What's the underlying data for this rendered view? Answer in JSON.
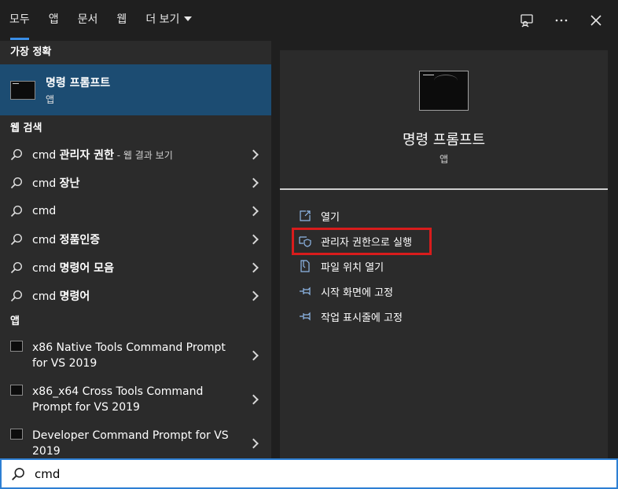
{
  "tabs": {
    "all": "모두",
    "apps": "앱",
    "documents": "문서",
    "web": "웹",
    "more": "더 보기"
  },
  "left": {
    "best_match_label": "가장 정확",
    "best_match": {
      "title": "명령 프롬프트",
      "subtitle": "앱"
    },
    "web_search_label": "웹 검색",
    "web_items": [
      {
        "prefix": "cmd ",
        "bold": "관리자 권한",
        "hint": " - 웹 결과 보기"
      },
      {
        "prefix": "cmd ",
        "bold": "장난",
        "hint": ""
      },
      {
        "prefix": "cmd",
        "bold": "",
        "hint": ""
      },
      {
        "prefix": "cmd ",
        "bold": "정품인증",
        "hint": ""
      },
      {
        "prefix": "cmd ",
        "bold": "명령어 모음",
        "hint": ""
      },
      {
        "prefix": "cmd ",
        "bold": "명령어",
        "hint": ""
      }
    ],
    "apps_label": "앱",
    "app_items": [
      {
        "label": "x86 Native Tools Command Prompt for VS 2019"
      },
      {
        "label": "x86_x64 Cross Tools Command Prompt for VS 2019"
      },
      {
        "label": "Developer Command Prompt for VS 2019"
      }
    ]
  },
  "detail": {
    "title": "명령 프롬프트",
    "subtitle": "앱",
    "actions": [
      {
        "label": "열기",
        "icon": "open-icon"
      },
      {
        "label": "관리자 권한으로 실행",
        "icon": "shield-icon"
      },
      {
        "label": "파일 위치 열기",
        "icon": "file-location-icon"
      },
      {
        "label": "시작 화면에 고정",
        "icon": "pin-icon"
      },
      {
        "label": "작업 표시줄에 고정",
        "icon": "pin-icon"
      }
    ]
  },
  "search": {
    "value": "cmd"
  },
  "colors": {
    "accent": "#3a8ee6",
    "selection": "#1c4c72",
    "highlight": "#d81c1c"
  }
}
